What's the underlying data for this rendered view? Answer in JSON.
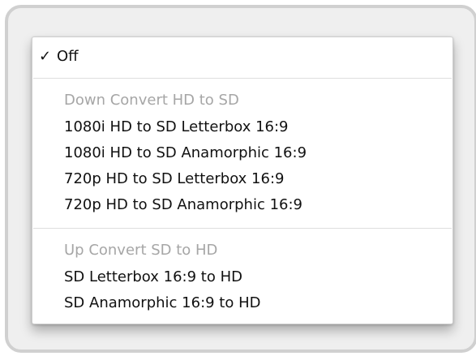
{
  "menu": {
    "selected": {
      "check": "✓",
      "label": "Off"
    },
    "groups": [
      {
        "header": "Down Convert HD to SD",
        "items": [
          "1080i HD to SD Letterbox 16:9",
          "1080i HD to SD Anamorphic 16:9",
          "720p HD to SD Letterbox 16:9",
          "720p HD to SD Anamorphic 16:9"
        ]
      },
      {
        "header": "Up Convert SD to HD",
        "items": [
          "SD Letterbox 16:9 to HD",
          "SD Anamorphic 16:9 to HD"
        ]
      }
    ]
  }
}
